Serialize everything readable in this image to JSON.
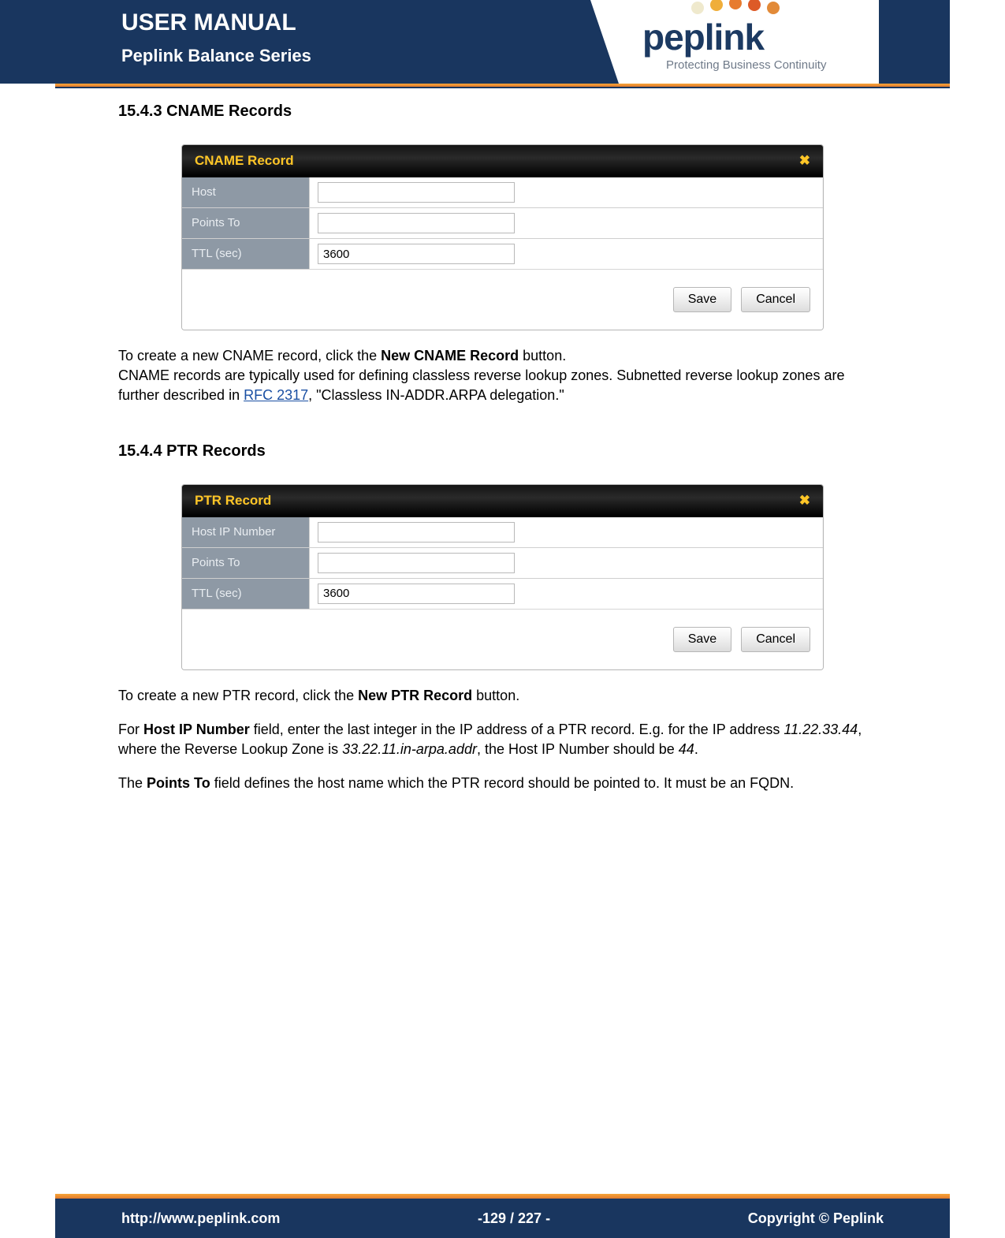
{
  "header": {
    "title": "USER MANUAL",
    "subtitle": "Peplink Balance Series",
    "logo_text_pre": "pep",
    "logo_text_post": "link",
    "logo_tag": "Protecting Business Continuity"
  },
  "section_cname": {
    "heading": "15.4.3 CNAME Records",
    "panel_title": "CNAME Record",
    "rows": {
      "host_label": "Host",
      "host_value": "",
      "points_label": "Points To",
      "points_value": "",
      "ttl_label": "TTL (sec)",
      "ttl_value": "3600"
    },
    "save": "Save",
    "cancel": "Cancel",
    "text_a": "To create a new CNAME record, click the ",
    "text_b_bold": "New CNAME Record",
    "text_c": " button.",
    "text2_a": "CNAME records are typically used for defining classless reverse lookup zones. Subnetted reverse lookup zones are further described in ",
    "rfc_link": "RFC 2317",
    "text2_b": ", \"Classless IN-ADDR.ARPA delegation.\""
  },
  "section_ptr": {
    "heading": "15.4.4 PTR Records",
    "panel_title": "PTR Record",
    "rows": {
      "hostip_label": "Host IP Number",
      "hostip_value": "",
      "points_label": "Points To",
      "points_value": "",
      "ttl_label": "TTL (sec)",
      "ttl_value": "3600"
    },
    "save": "Save",
    "cancel": "Cancel",
    "p1_a": "To create a new PTR record, click the ",
    "p1_b_bold": "New PTR Record",
    "p1_c": " button.",
    "p2_a": "For ",
    "p2_b_bold": "Host IP Number",
    "p2_c": " field, enter the last integer in the IP address of a PTR record. E.g. for the IP address ",
    "p2_d_italic": "11.22.33.44",
    "p2_e": ", where the Reverse Lookup Zone is ",
    "p2_f_italic": "33.22.11.in-arpa.addr",
    "p2_g": ", the Host IP Number should be ",
    "p2_h_italic": "44",
    "p2_i": ".",
    "p3_a": "The ",
    "p3_b_bold": "Points To",
    "p3_c": " field defines the host name which the PTR record should be pointed to. It must be an FQDN."
  },
  "footer": {
    "url": "http://www.peplink.com",
    "page": "-129 / 227 -",
    "copyright": "Copyright ©  Peplink"
  }
}
